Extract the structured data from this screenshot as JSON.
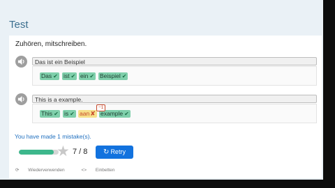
{
  "header": {
    "title": "Test"
  },
  "instruction": "Zuhören, mitschreiben.",
  "exercises": [
    {
      "sentence": "Das ist ein Beispiel",
      "words": [
        {
          "text": "Das",
          "correct": true
        },
        {
          "text": "ist",
          "correct": true
        },
        {
          "text": "ein",
          "correct": true
        },
        {
          "text": "Beispiel",
          "correct": true
        }
      ]
    },
    {
      "sentence": "This is a example.",
      "words": [
        {
          "text": "This",
          "correct": true
        },
        {
          "text": "is",
          "correct": true
        },
        {
          "text": "aan",
          "correct": false,
          "badge": "−1"
        },
        {
          "text": "example",
          "correct": true
        }
      ]
    }
  ],
  "result": {
    "mistakes_text": "You have made 1 mistake(s).",
    "score": "7 / 8",
    "progress": 0.875,
    "retry_label": "Retry"
  },
  "footer": {
    "reuse_label": "Wiederverwenden",
    "embed_label": "Einbetten"
  },
  "colors": {
    "correct_chip": "#7fcfab",
    "wrong_chip": "#f6e08a",
    "accent": "#1272de"
  }
}
